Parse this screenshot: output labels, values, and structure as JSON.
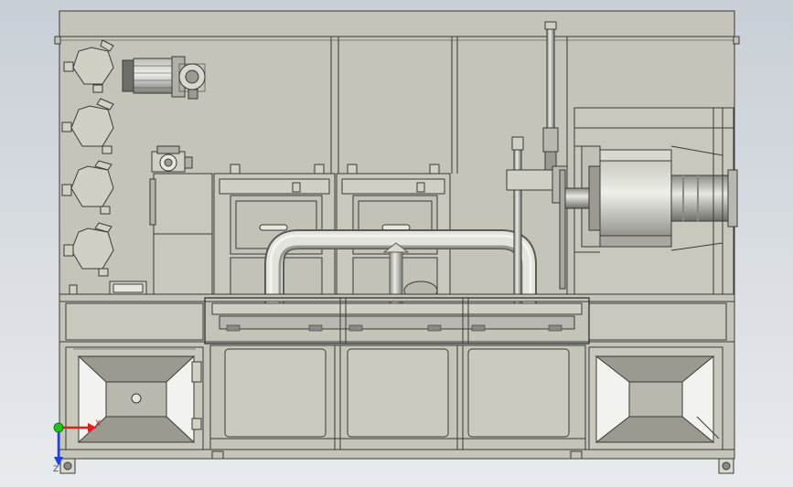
{
  "viewport": {
    "background_top": "#c9cfd6",
    "background_bottom": "#e8ebee"
  },
  "colors": {
    "line": "#3a3a3a",
    "panel": "#c4c4b8",
    "panel_light": "#d0d0c4",
    "hopper_white": "#f2f2ee",
    "hopper_dark": "#9a9a90",
    "metal_dark": "#6e6e68",
    "pipe_light": "#e4e4de",
    "pipe_mid": "#b8b8b0",
    "pipe_dark": "#8a8a84",
    "axis_x": "#e02020",
    "axis_y": "#20c020",
    "axis_z": "#2040e0"
  },
  "axis_triad": {
    "x_label": "X",
    "z_label": "Z"
  }
}
